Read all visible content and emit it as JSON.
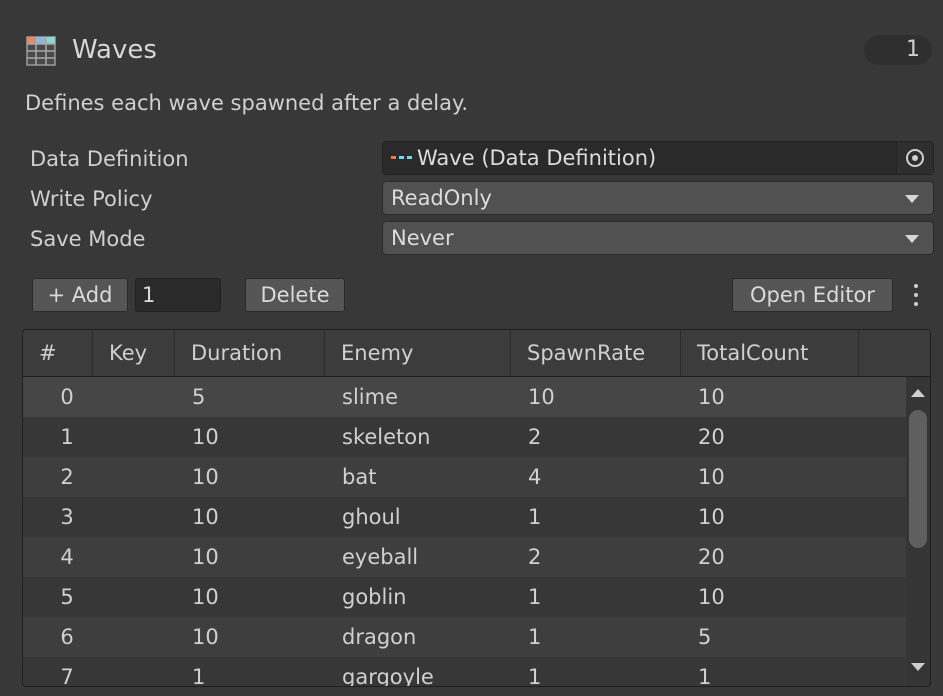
{
  "header": {
    "title": "Waves",
    "count": "1",
    "icon": "table-icon"
  },
  "description": "Defines each wave spawned after a delay.",
  "properties": {
    "data_definition": {
      "label": "Data Definition",
      "value": "Wave (Data Definition)",
      "icon": "data-definition-icon"
    },
    "write_policy": {
      "label": "Write Policy",
      "value": "ReadOnly"
    },
    "save_mode": {
      "label": "Save Mode",
      "value": "Never"
    }
  },
  "toolbar": {
    "add_label": "+ Add",
    "add_count": "1",
    "delete_label": "Delete",
    "open_editor_label": "Open Editor"
  },
  "table": {
    "columns": [
      "#",
      "Key",
      "Duration",
      "Enemy",
      "SpawnRate",
      "TotalCount"
    ],
    "rows": [
      {
        "index": "0",
        "key": "",
        "duration": "5",
        "enemy": "slime",
        "spawn_rate": "10",
        "total_count": "10"
      },
      {
        "index": "1",
        "key": "",
        "duration": "10",
        "enemy": "skeleton",
        "spawn_rate": "2",
        "total_count": "20"
      },
      {
        "index": "2",
        "key": "",
        "duration": "10",
        "enemy": "bat",
        "spawn_rate": "4",
        "total_count": "10"
      },
      {
        "index": "3",
        "key": "",
        "duration": "10",
        "enemy": "ghoul",
        "spawn_rate": "1",
        "total_count": "10"
      },
      {
        "index": "4",
        "key": "",
        "duration": "10",
        "enemy": "eyeball",
        "spawn_rate": "2",
        "total_count": "20"
      },
      {
        "index": "5",
        "key": "",
        "duration": "10",
        "enemy": "goblin",
        "spawn_rate": "1",
        "total_count": "10"
      },
      {
        "index": "6",
        "key": "",
        "duration": "10",
        "enemy": "dragon",
        "spawn_rate": "1",
        "total_count": "5"
      },
      {
        "index": "7",
        "key": "",
        "duration": "1",
        "enemy": "gargoyle",
        "spawn_rate": "1",
        "total_count": "1"
      }
    ]
  },
  "colors": {
    "background": "#383838",
    "field_dark": "#2a2a2a",
    "button": "#555555",
    "row_even": "#3e3e3e",
    "row_odd": "#373737",
    "row_selected": "#464646",
    "dd_icon_orange": "#e8804a",
    "dd_icon_cyan": "#7ad4ee"
  }
}
